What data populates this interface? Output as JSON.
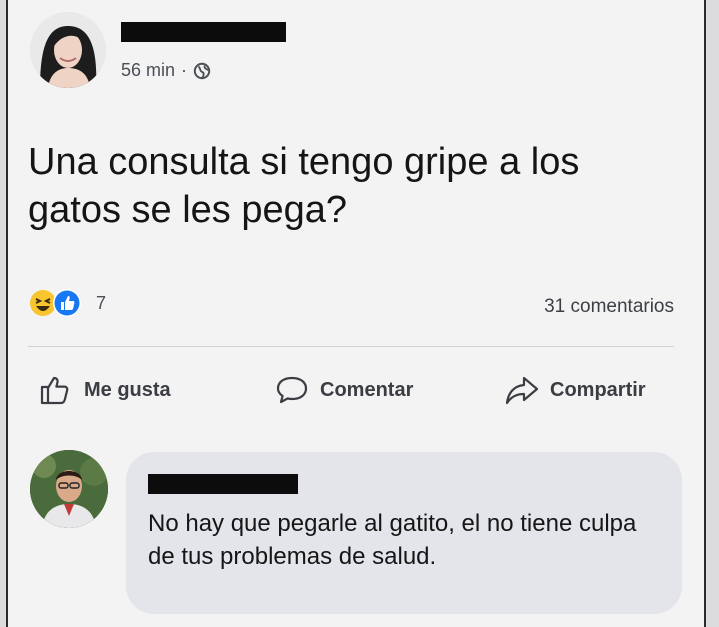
{
  "post": {
    "time": "56 min",
    "separator": "·",
    "privacy_icon": "globe-icon",
    "text": "Una consulta si tengo gripe a los gatos se les pega?",
    "reactions": {
      "icons": [
        "haha-reaction-icon",
        "like-reaction-icon"
      ],
      "count": "7"
    },
    "comments_count": "31 comentarios"
  },
  "actions": {
    "like_label": "Me gusta",
    "comment_label": "Comentar",
    "share_label": "Compartir"
  },
  "comment": {
    "text": "No hay que pegarle al gatito, el no tiene culpa de tus problemas de salud."
  },
  "colors": {
    "like_blue": "#1877f2",
    "haha_yellow": "#f7c52e",
    "card_bg": "#f3f3f4",
    "bubble_bg": "#e4e5ea"
  }
}
